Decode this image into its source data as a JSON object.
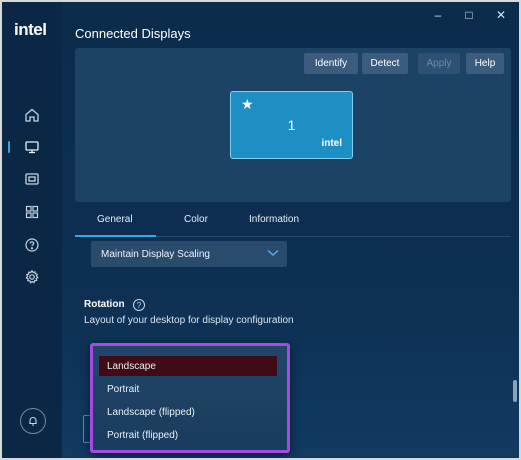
{
  "sidebar": {
    "logo": "intel",
    "items": [
      {
        "name": "home-icon"
      },
      {
        "name": "display-icon"
      },
      {
        "name": "video-icon"
      },
      {
        "name": "apps-grid-icon"
      },
      {
        "name": "help-icon"
      },
      {
        "name": "settings-gear-icon"
      }
    ],
    "active_index": 1
  },
  "window_controls": {
    "minimize": "–",
    "maximize": "□",
    "close": "✕"
  },
  "header": {
    "title": "Connected Displays"
  },
  "toolbar": {
    "identify": "Identify",
    "detect": "Detect",
    "apply": "Apply",
    "help": "Help"
  },
  "monitor": {
    "star": "★",
    "number": "1",
    "brand": "intel"
  },
  "tabs": [
    {
      "label": "General",
      "active": true
    },
    {
      "label": "Color",
      "active": false
    },
    {
      "label": "Information",
      "active": false
    }
  ],
  "scaling": {
    "value": "Maintain Display Scaling"
  },
  "rotation": {
    "title": "Rotation",
    "info_symbol": "?",
    "description": "Layout of your desktop for display configuration",
    "options": [
      "Landscape",
      "Portrait",
      "Landscape (flipped)",
      "Portrait (flipped)"
    ],
    "selected": "Landscape"
  },
  "colors": {
    "accent": "#3aa6ec",
    "highlight_border": "#a24ce0",
    "selected_option_bg": "#3e0b16",
    "monitor_fill": "#1e8fc4"
  }
}
